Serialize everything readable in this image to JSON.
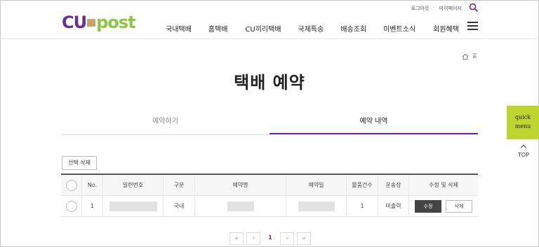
{
  "header": {
    "logo_cu": "CU",
    "logo_post": "post",
    "util_logout": "로그아웃",
    "util_sep": "·",
    "util_mypage": "마이페이지",
    "nav": [
      "국내택배",
      "홈택배",
      "CU끼리택배",
      "국제특송",
      "배송조회",
      "이벤트소식",
      "회원혜택"
    ]
  },
  "breadcrumb": {
    "home_label": "홈"
  },
  "page_title": "택배 예약",
  "tabs": [
    {
      "label": "예약하기",
      "active": false
    },
    {
      "label": "예약 내역",
      "active": true
    }
  ],
  "quick_menu": {
    "line1": "quick",
    "line2": "menu",
    "top_label": "TOP"
  },
  "actions": {
    "delete_selected": "선택 삭제"
  },
  "table": {
    "headers": [
      "",
      "No.",
      "일련번호",
      "구분",
      "예약명",
      "예약일",
      "물품건수",
      "운송장",
      "수정 및 삭제"
    ],
    "rows": [
      {
        "no": "1",
        "serial": "",
        "type": "국내",
        "name": "",
        "date": "",
        "count": "1",
        "waybill": "미출력",
        "edit": "수정",
        "delete": "삭제"
      }
    ]
  },
  "pagination": {
    "first": "«",
    "prev": "‹",
    "current": "1",
    "next": "›",
    "last": "»"
  },
  "colors": {
    "brand_purple": "#6c2d91",
    "brand_green": "#8dc63f",
    "quick_bg": "#bcd52f"
  }
}
